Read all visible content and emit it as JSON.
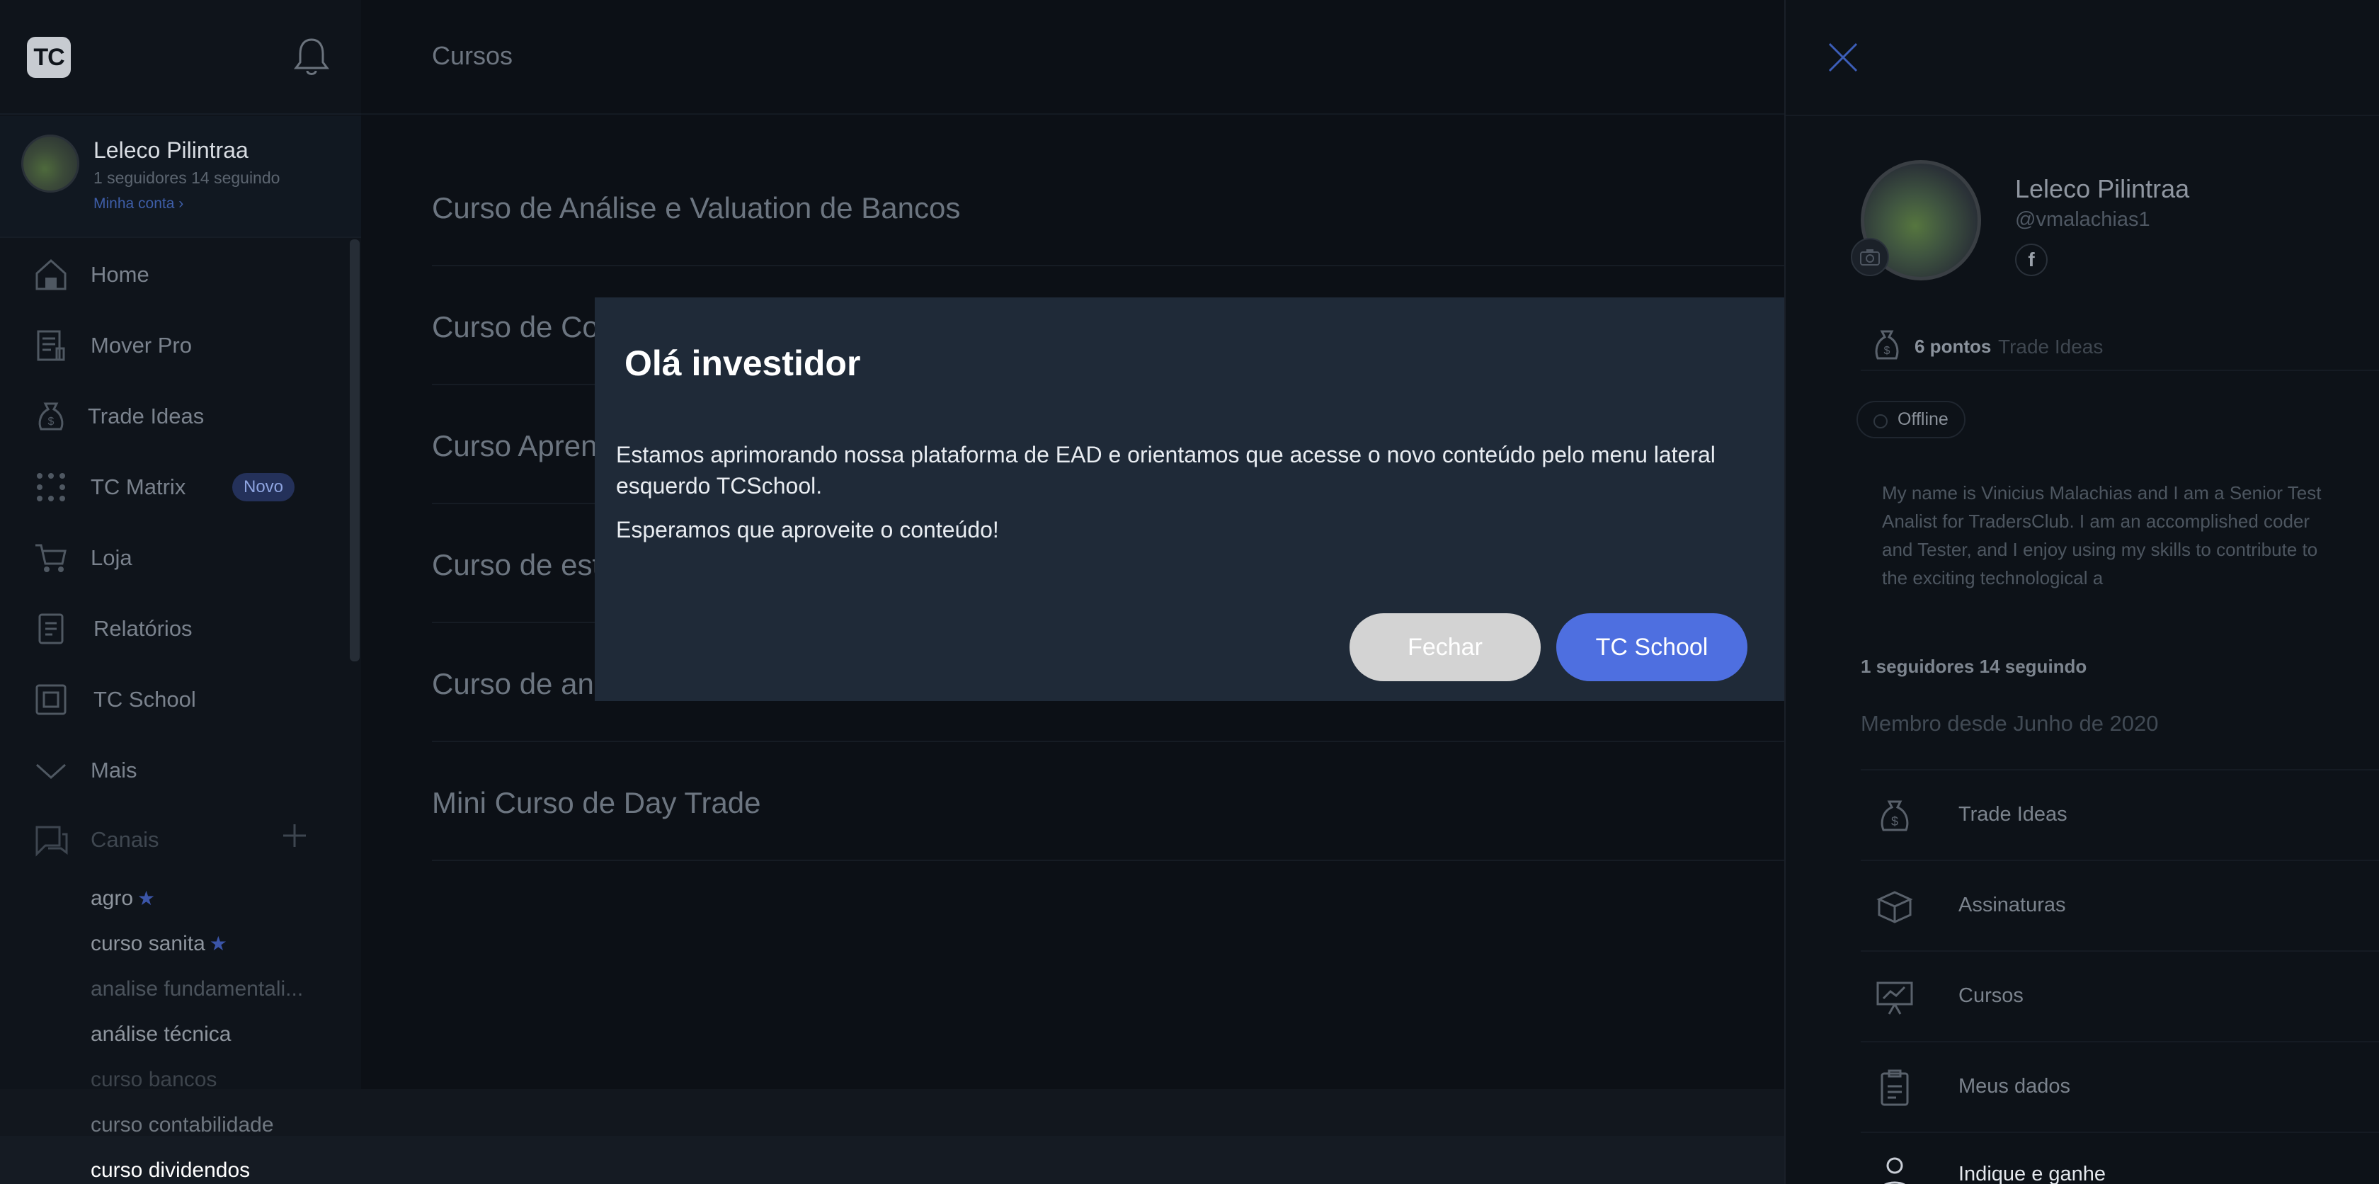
{
  "sidebar": {
    "logo_text": "TC",
    "profile": {
      "name": "Leleco Pilintraa",
      "stats": "1 seguidores   14 seguindo",
      "account_link": "Minha conta ›"
    },
    "nav": [
      {
        "label": "Home",
        "icon": "home-icon"
      },
      {
        "label": "Mover Pro",
        "icon": "document-icon"
      },
      {
        "label": "Trade Ideas",
        "icon": "money-bag-icon"
      },
      {
        "label": "TC Matrix",
        "icon": "grid-dots-icon",
        "badge": "Novo"
      },
      {
        "label": "Loja",
        "icon": "cart-icon"
      },
      {
        "label": "Relatórios",
        "icon": "report-icon"
      },
      {
        "label": "TC School",
        "icon": "school-icon"
      },
      {
        "label": "Mais",
        "icon": "chevron-down-icon"
      }
    ],
    "channels_label": "Canais",
    "channels": [
      {
        "label": "agro",
        "starred": true,
        "color": "#8e959e"
      },
      {
        "label": "curso sanita",
        "starred": true,
        "color": "#8e959e"
      },
      {
        "label": "analise fundamentali...",
        "starred": false,
        "color": "#4b535c"
      },
      {
        "label": "análise técnica",
        "starred": false,
        "color": "#8e959e"
      },
      {
        "label": "curso bancos",
        "starred": false,
        "color": "#3d444c"
      },
      {
        "label": "curso contabilidade",
        "starred": false,
        "color": "#6f7780"
      },
      {
        "label": "curso dividendos",
        "starred": false,
        "color": "#ffffff"
      }
    ]
  },
  "main": {
    "title": "Cursos",
    "courses": [
      "Curso de Análise e Valuation de Bancos",
      "Curso de Co",
      "Curso Apren",
      "Curso de est",
      "Curso de ana",
      "Mini Curso de Day Trade"
    ]
  },
  "modal": {
    "title": "Olá investidor",
    "text1": "Estamos aprimorando nossa plataforma de EAD e orientamos que acesse o novo conteúdo pelo menu lateral esquerdo TCSchool.",
    "text2": "Esperamos que aproveite o conteúdo!",
    "close_label": "Fechar",
    "school_label": "TC School"
  },
  "profile_panel": {
    "name": "Leleco Pilintraa",
    "handle": "@vmalachias1",
    "points": "6 pontos",
    "points_sub": "Trade Ideas",
    "status": "Offline",
    "bio": "My name is Vinicius Malachias and I am a Senior Test Analist for TradersClub. I am an accomplished coder and Tester, and I enjoy using my skills to contribute to the exciting technological a",
    "follow": "1 seguidores   14 seguindo",
    "member_since": "Membro desde Junho de 2020",
    "menu": [
      {
        "label": "Trade Ideas",
        "icon": "money-bag-icon"
      },
      {
        "label": "Assinaturas",
        "icon": "box-icon"
      },
      {
        "label": "Cursos",
        "icon": "presentation-icon"
      },
      {
        "label": "Meus dados",
        "icon": "clipboard-icon"
      },
      {
        "label": "Indique e ganhe",
        "icon": "user-icon"
      }
    ]
  },
  "colors": {
    "accent": "#4e6fe0",
    "modal_bg": "#1f2a38",
    "close_button": "#d3d3d3"
  }
}
